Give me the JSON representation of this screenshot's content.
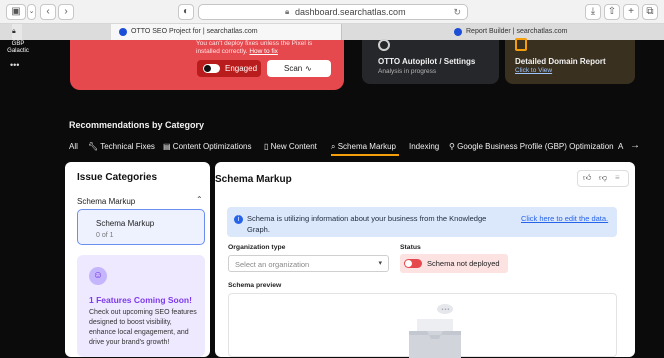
{
  "browser": {
    "url": "dashboard.searchatlas.com",
    "tabs": [
      {
        "title": "OTTO SEO Project for | searchatlas.com",
        "active": true
      },
      {
        "title": "Report Builder | searchatlas.com",
        "active": false
      }
    ]
  },
  "rail": {
    "workspace_line1": "GBP",
    "workspace_line2": "Galactic",
    "more_label": "•••"
  },
  "otto_card": {
    "message_line1": "You can't deploy fixes unless the Pixel is",
    "message_line2": "installed correctly.",
    "message_link": "How to fix",
    "engaged_label": "Engaged",
    "scan_label": "Scan"
  },
  "autopilot_card": {
    "title": "OTTO Autopilot / Settings",
    "subtitle": "Analysis in progress"
  },
  "report_card": {
    "title": "Detailed Domain Report",
    "link": "Click to View"
  },
  "recommendations": {
    "heading": "Recommendations by Category",
    "categories": [
      "All",
      "Technical Fixes",
      "Content Optimizations",
      "New Content",
      "Schema Markup",
      "Indexing",
      "Google Business Profile (GBP) Optimization",
      "A"
    ]
  },
  "issue_categories": {
    "heading": "Issue Categories",
    "group_label": "Schema Markup",
    "item_label": "Schema Markup",
    "item_count": "0 of 1",
    "promo_title": "1 Features Coming Soon!",
    "promo_body": "Check out upcoming SEO features designed to boost visibility, enhance local engagement, and drive your brand's growth!"
  },
  "schema_panel": {
    "title": "Schema Markup",
    "info_text": "Schema is utilizing information about your business from the Knowledge Graph.",
    "info_link": "Click here to edit the data.",
    "org_label": "Organization type",
    "org_placeholder": "Select an organization",
    "status_label": "Status",
    "status_value": "Schema not deployed",
    "preview_label": "Schema preview"
  },
  "colors": {
    "accent_orange": "#f59e0b",
    "danger_red": "#e5484d",
    "link_blue": "#2563eb",
    "promo_purple": "#7c3aed"
  }
}
